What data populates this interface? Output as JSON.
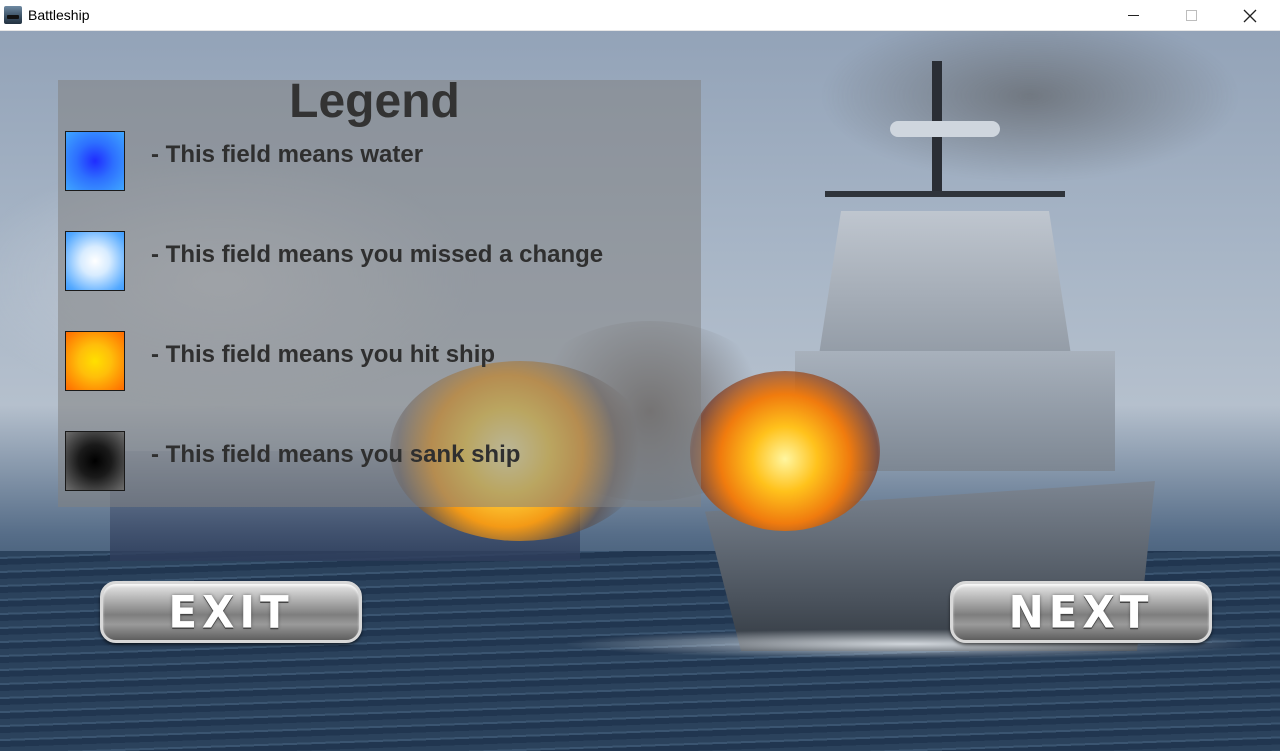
{
  "window": {
    "title": "Battleship",
    "controls": {
      "minimize": "—",
      "maximize": "☐",
      "close": "✕"
    }
  },
  "legend": {
    "title": "Legend",
    "items": [
      {
        "icon": "water-field-swatch",
        "label": "- This field means water",
        "color": "#2d6fff"
      },
      {
        "icon": "miss-field-swatch",
        "label": "- This field means you missed a change",
        "color": "#ffffff"
      },
      {
        "icon": "hit-field-swatch",
        "label": "- This field means you hit ship",
        "color": "#ffb000"
      },
      {
        "icon": "sank-field-swatch",
        "label": "- This field means you sank ship",
        "color": "#000000"
      }
    ]
  },
  "buttons": {
    "exit": "EXIT",
    "next": "NEXT"
  }
}
